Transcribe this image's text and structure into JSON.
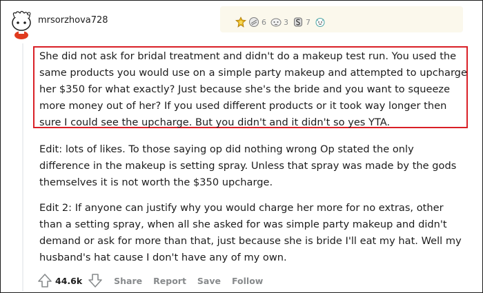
{
  "comment": {
    "username": "mrsorzhova728",
    "separator": "·",
    "awards": [
      {
        "icon": "gold-medal-icon",
        "count": ""
      },
      {
        "icon": "wholesome-award-icon",
        "count": "6"
      },
      {
        "icon": "helpful-award-icon",
        "count": "3"
      },
      {
        "icon": "silver-award-icon",
        "count": "7"
      },
      {
        "icon": "hugz-award-icon",
        "count": ""
      }
    ],
    "paragraphs": [
      "She did not ask for bridal treatment and didn't do a makeup test run. You used the same products you would use on a simple party makeup and attempted to upcharge her $350 for what exactly? Just because she's the bride and you want to squeeze more money out of her? If you used different products or it took way longer then sure I could see the upcharge. But you didn't and it didn't so yes YTA.",
      "Edit: lots of likes. To those saying op did nothing wrong Op stated the only difference in the makeup is setting spray. Unless that spray was made by the gods themselves it is not worth the $350 upcharge.",
      "Edit 2: If anyone can justify why you would charge her more for no extras, other than a setting spray, when all she asked for was simple party makeup and didn't demand or ask for more than that, just because she is bride I'll eat my hat. Well my husband's hat cause I don't have any of my own."
    ],
    "highlight_color": "#d91f26"
  },
  "actions": {
    "score": "44.6k",
    "share": "Share",
    "report": "Report",
    "save": "Save",
    "follow": "Follow"
  }
}
